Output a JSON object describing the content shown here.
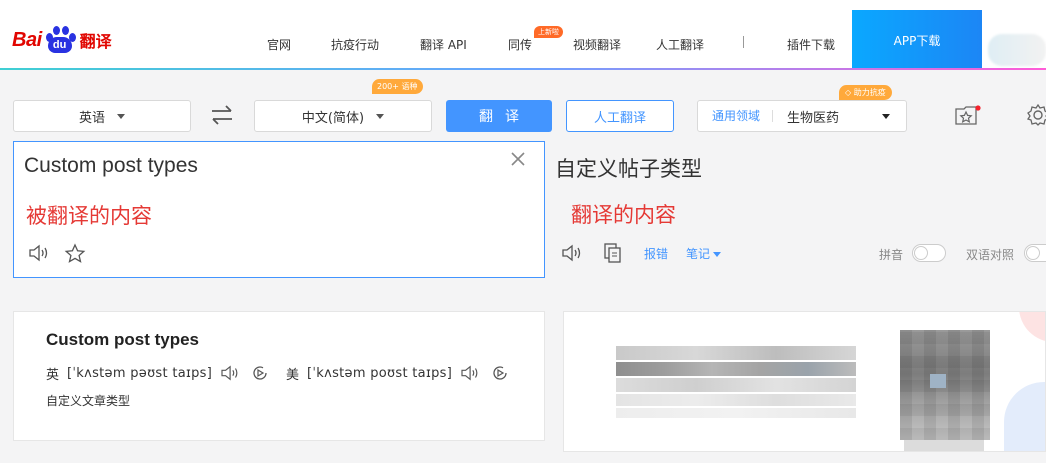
{
  "header": {
    "logo": {
      "bai": "Bai",
      "du": "du",
      "product": "翻译"
    },
    "nav": [
      {
        "label": "官网"
      },
      {
        "label": "抗疫行动"
      },
      {
        "label": "翻译 API"
      },
      {
        "label": "同传"
      },
      {
        "label": "视频翻译"
      },
      {
        "label": "人工翻译"
      },
      {
        "label": "插件下载"
      }
    ],
    "nav_badge": "上新啦",
    "app_button": "APP下载"
  },
  "toolbar": {
    "source_lang": "英语",
    "target_lang": "中文(简体)",
    "lang_badge": "200+ 语种",
    "translate_button": "翻译",
    "human_button": "人工翻译",
    "domain_label": "通用领域",
    "domain_value": "生物医药",
    "domain_badge": "助力抗疫"
  },
  "source": {
    "text": "Custom post types",
    "note": "被翻译的内容"
  },
  "target": {
    "text": "自定义帖子类型",
    "note": "翻译的内容",
    "report": "报错",
    "notes": "笔记",
    "pinyin": "拼音",
    "bilingual": "双语对照"
  },
  "dictionary": {
    "word": "Custom post types",
    "uk_label": "英",
    "uk_ipa": "[ˈkʌstəm pəʊst taɪps]",
    "us_label": "美",
    "us_ipa": "[ˈkʌstəm poʊst taɪps]",
    "meaning": "自定义文章类型"
  },
  "colors": {
    "accent": "#4395ff",
    "note_red": "#e53935",
    "badge_orange": "#ffa93b",
    "logo_red": "#e10601",
    "logo_blue": "#2932e1"
  }
}
